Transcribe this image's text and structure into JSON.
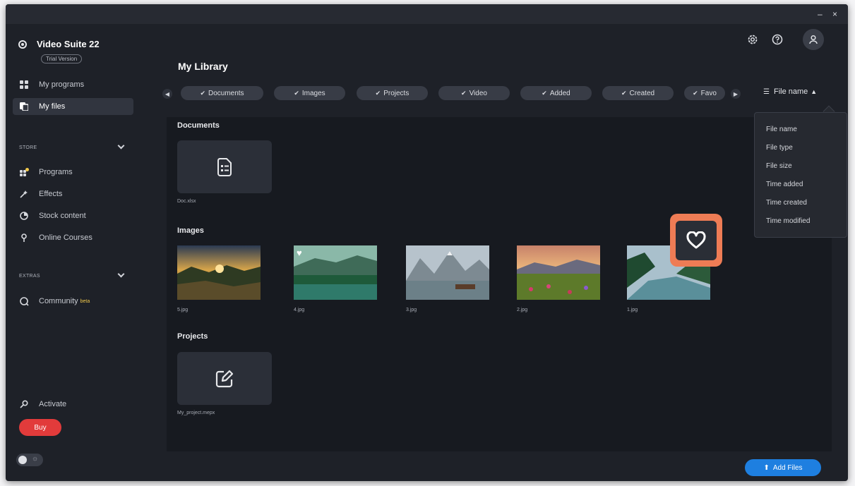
{
  "window_controls": {
    "minimize": "–",
    "close": "×"
  },
  "app": {
    "name": "Video Suite 22",
    "edition": "Trial Version"
  },
  "sidebar": {
    "main_items": [
      {
        "label": "My programs",
        "icon": "grid-icon"
      },
      {
        "label": "My files",
        "icon": "files-icon",
        "active": true
      }
    ],
    "store": {
      "label": "STORE",
      "items": [
        {
          "label": "Programs",
          "icon": "apps-icon"
        },
        {
          "label": "Effects",
          "icon": "effects-icon"
        },
        {
          "label": "Stock content",
          "icon": "stock-icon"
        },
        {
          "label": "Online Courses",
          "icon": "location-pin-icon"
        }
      ]
    },
    "extras": {
      "label": "EXTRAS",
      "items": [
        {
          "label": "Community",
          "badge": "beta",
          "icon": "chat-icon"
        }
      ]
    },
    "activate_label": "Activate",
    "buy_label": "Buy"
  },
  "header": {
    "title": "My Library"
  },
  "filters": [
    "Documents",
    "Images",
    "Projects",
    "Video",
    "Added",
    "Created",
    "Favo"
  ],
  "sort": {
    "current": "File name",
    "options": [
      "File name",
      "File type",
      "File size",
      "Time added",
      "Time created",
      "Time modified"
    ]
  },
  "groups": {
    "documents": {
      "title": "Documents",
      "files": [
        {
          "name": "Doc.xlsx"
        }
      ]
    },
    "images": {
      "title": "Images",
      "files": [
        {
          "name": "5.jpg"
        },
        {
          "name": "4.jpg",
          "favorite": true
        },
        {
          "name": "3.jpg"
        },
        {
          "name": "2.jpg"
        },
        {
          "name": "1.jpg"
        }
      ]
    },
    "projects": {
      "title": "Projects",
      "files": [
        {
          "name": "My_project.mepx"
        }
      ]
    }
  },
  "add_files_label": "Add Files",
  "colors": {
    "background": "#1e2128",
    "content": "#171a20",
    "accent_blue": "#1e7fe0",
    "buy_red": "#e23b3b",
    "highlight_orange": "#ee7c55",
    "beta_yellow": "#f2c94c"
  }
}
